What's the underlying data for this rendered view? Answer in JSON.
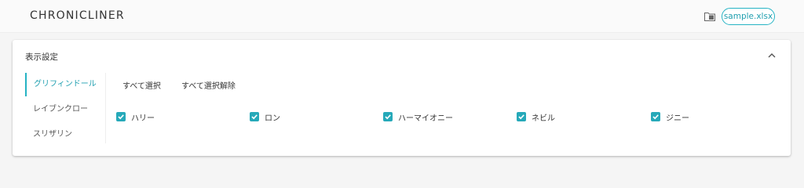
{
  "app": {
    "logo": "CHRONICLINER",
    "file_name": "sample.xlsx"
  },
  "panel": {
    "title": "表示設定"
  },
  "tabs": [
    {
      "label": "グリフィンドール",
      "active": true
    },
    {
      "label": "レイブンクロー",
      "active": false
    },
    {
      "label": "スリザリン",
      "active": false
    }
  ],
  "actions": {
    "select_all": "すべて選択",
    "deselect_all": "すべて選択解除"
  },
  "checkboxes": [
    {
      "label": "ハリー",
      "checked": true
    },
    {
      "label": "ロン",
      "checked": true
    },
    {
      "label": "ハーマイオニー",
      "checked": true
    },
    {
      "label": "ネビル",
      "checked": true
    },
    {
      "label": "ジニー",
      "checked": true
    }
  ],
  "colors": {
    "accent": "#26b3c4",
    "checkbox": "#26a9b9"
  },
  "icons": {
    "file": "folder-icon",
    "collapse": "chevron-up-icon",
    "check": "check-icon"
  }
}
